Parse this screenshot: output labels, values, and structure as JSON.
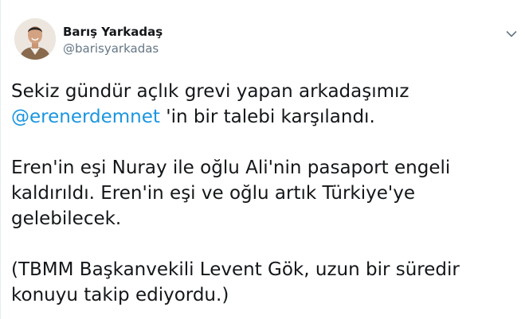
{
  "author": {
    "display_name": "Barış Yarkadaş",
    "handle": "@barisyarkadas"
  },
  "menu": {
    "icon": "chevron-down-icon"
  },
  "tweet": {
    "line1": "Sekiz gündür açlık grevi yapan arkadaşımız",
    "mention": "@erenerdemnet",
    "line2_after_mention": " 'in bir talebi karşılandı.",
    "line3": "Eren'in eşi Nuray ile oğlu Ali'nin pasaport engeli",
    "line4": "kaldırıldı. Eren'in eşi ve oğlu artık Türkiye'ye",
    "line5": "gelebilecek.",
    "line6": "(TBMM Başkanvekili Levent Gök, uzun bir süredir",
    "line7": "konuyu takip ediyordu.)"
  },
  "colors": {
    "text": "#14171a",
    "secondary": "#657786",
    "link": "#1b95e0"
  }
}
